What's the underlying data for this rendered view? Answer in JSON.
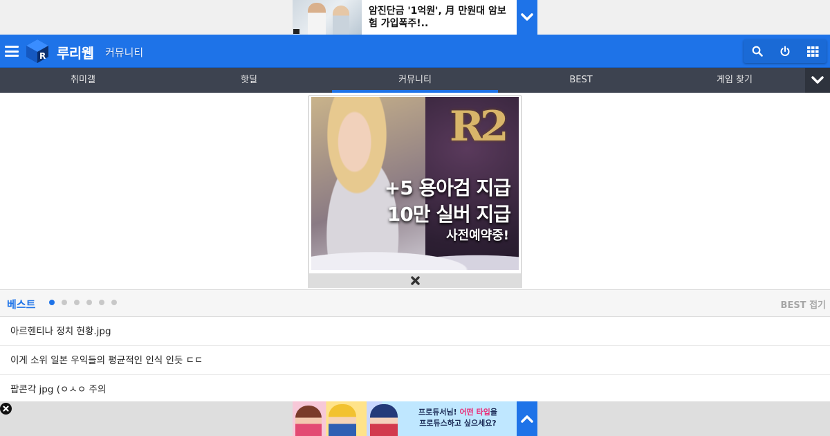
{
  "top_ad": {
    "text": "암진단금 '1억원', 月 만원대 암보험 가입폭주!.."
  },
  "header": {
    "brand": "루리웹",
    "section": "커뮤니티"
  },
  "nav": {
    "items": [
      "취미갤",
      "핫딜",
      "커뮤니티",
      "BEST",
      "게임 찾기"
    ],
    "active": "커뮤니티"
  },
  "mid_ad": {
    "line1": "+5 용아검 지급",
    "line2": "10만 실버 지급",
    "line3": "사전예약중!"
  },
  "best": {
    "title": "베스트",
    "fold_label": "BEST 접기",
    "page_count": 6,
    "active_page": 1,
    "items": [
      "아르헨티나 정치 현황.jpg",
      "이게 소위 일본 우익들의 평균적인 인식 인듯 ㄷㄷ",
      "팝콘각 jpg (ㅇㅅㅇ 주의"
    ]
  },
  "bottom_ad": {
    "caption_pre": "프로듀서님!",
    "caption_highlight": "어떤 타입",
    "caption_post": "을",
    "caption_line2": "프로듀스하고 싶으세요?"
  },
  "colors": {
    "brand_blue": "#1e73e8",
    "nav_dark": "#3d4350"
  }
}
